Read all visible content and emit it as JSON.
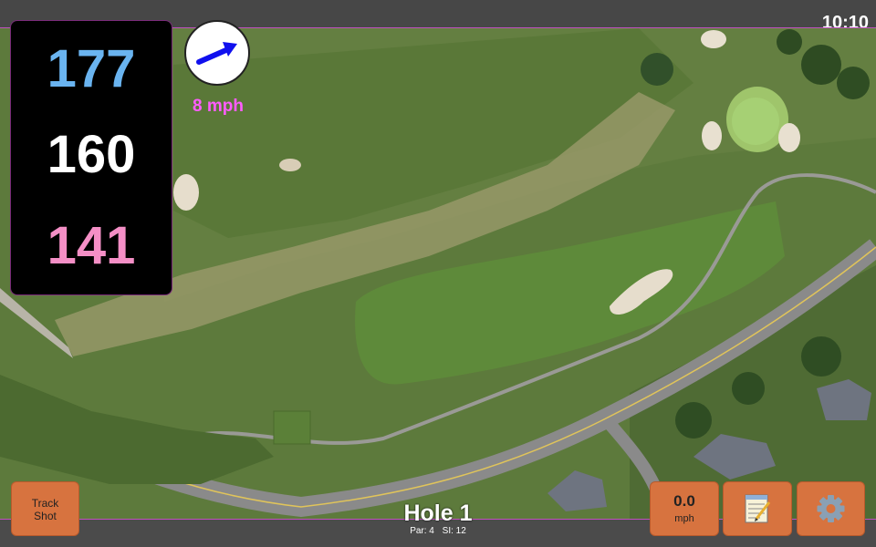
{
  "status": {
    "time": "10:10"
  },
  "distances": {
    "back": "177",
    "middle": "160",
    "front": "141"
  },
  "wind": {
    "speed": "8 mph",
    "direction_icon": "arrow-icon"
  },
  "hole": {
    "title": "Hole 1",
    "par": "Par: 4",
    "stroke_index": "SI: 12"
  },
  "buttons": {
    "track_shot": {
      "line1": "Track",
      "line2": "Shot"
    },
    "speed": {
      "value": "0.0",
      "unit": "mph"
    },
    "notes_icon": "notepad-icon",
    "settings_icon": "gear-icon"
  },
  "colors": {
    "back": "#6ab4f0",
    "middle": "#ffffff",
    "front": "#f48fc6",
    "button": "#d7733f",
    "wind_text": "#ff5cff"
  }
}
